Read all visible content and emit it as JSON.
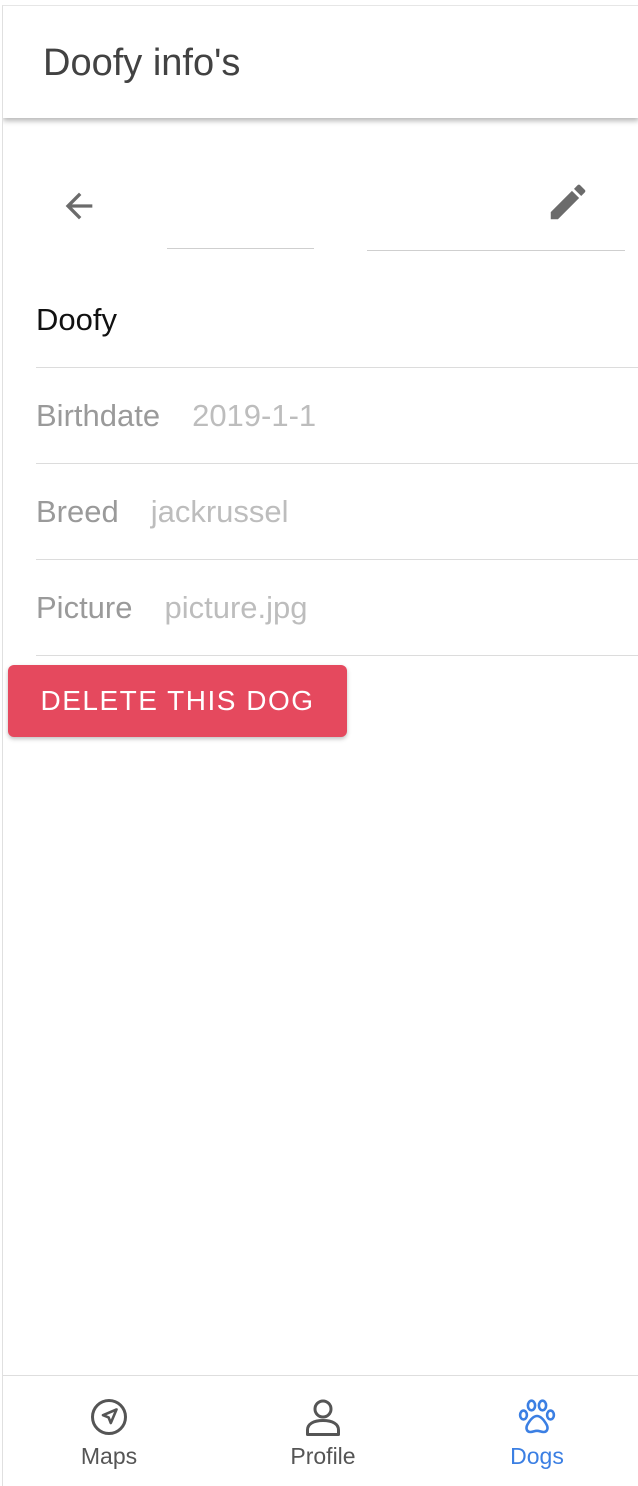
{
  "header": {
    "title": "Doofy info's"
  },
  "toolbar": {
    "back_icon": "arrow-left-icon",
    "edit_icon": "pencil-icon"
  },
  "dog": {
    "name": "Doofy",
    "fields": [
      {
        "label": "Birthdate",
        "value": "2019-1-1"
      },
      {
        "label": "Breed",
        "value": "jackrussel"
      },
      {
        "label": "Picture",
        "value": "picture.jpg"
      }
    ]
  },
  "actions": {
    "delete_label": "DELETE THIS DOG"
  },
  "bottom_nav": {
    "items": [
      {
        "label": "Maps",
        "icon": "navigation-arrow-icon",
        "active": false
      },
      {
        "label": "Profile",
        "icon": "person-icon",
        "active": false
      },
      {
        "label": "Dogs",
        "icon": "paw-icon",
        "active": true
      }
    ]
  },
  "colors": {
    "accent": "#3b7fe3",
    "danger": "#e5495e",
    "icon_gray": "#6b6b6b",
    "nav_inactive": "#555555"
  }
}
